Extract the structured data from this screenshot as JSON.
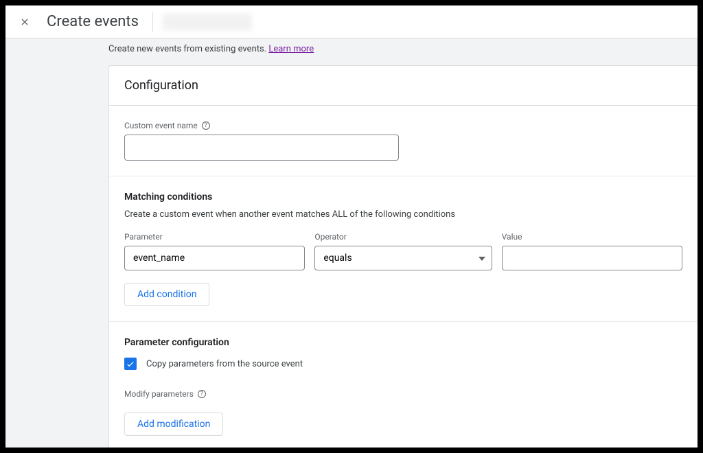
{
  "header": {
    "title": "Create events"
  },
  "intro": {
    "text": "Create new events from existing events. ",
    "link_text": "Learn more"
  },
  "panel": {
    "title": "Configuration"
  },
  "custom_event": {
    "label": "Custom event name",
    "value": ""
  },
  "matching": {
    "title": "Matching conditions",
    "description": "Create a custom event when another event matches ALL of the following conditions",
    "columns": {
      "parameter_label": "Parameter",
      "operator_label": "Operator",
      "value_label": "Value"
    },
    "row": {
      "parameter": "event_name",
      "operator": "equals",
      "value": ""
    },
    "add_button": "Add condition"
  },
  "param_config": {
    "title": "Parameter configuration",
    "copy_label": "Copy parameters from the source event",
    "copy_checked": true,
    "modify_label": "Modify parameters",
    "add_button": "Add modification"
  }
}
